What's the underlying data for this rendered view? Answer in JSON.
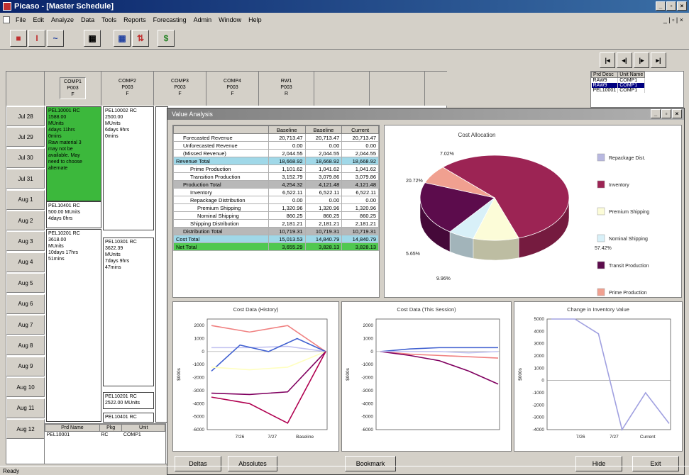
{
  "window": {
    "title": "Picaso - [Master Schedule]",
    "min": "_",
    "max": "▫",
    "close": "×"
  },
  "menu": [
    "File",
    "Edit",
    "Analyze",
    "Data",
    "Tools",
    "Reports",
    "Forecasting",
    "Admin",
    "Window",
    "Help"
  ],
  "menu_right": "_ | ▫ | ×",
  "toolbar": {
    "t1": "■",
    "t2": "I",
    "t3": "~",
    "t4": "▦",
    "t5": "▦",
    "t6": "⇅",
    "t7": "$"
  },
  "gridtools": [
    "|◂",
    "◂|",
    "|▸",
    "▸|"
  ],
  "schedule": {
    "columns": [
      {
        "name": "COMP1",
        "line2": "P003",
        "line3": "F"
      },
      {
        "name": "COMP2",
        "line2": "P003",
        "line3": "F"
      },
      {
        "name": "COMP3",
        "line2": "P003",
        "line3": "F"
      },
      {
        "name": "COMP4",
        "line2": "P003",
        "line3": "F"
      },
      {
        "name": "RW1",
        "line2": "P003",
        "line3": "R"
      }
    ],
    "rows": [
      "Jul 28",
      "Jul 29",
      "Jul 30",
      "Jul 31",
      "Aug 1",
      "Aug 2",
      "Aug 3",
      "Aug 4",
      "Aug 5",
      "Aug 6",
      "Aug 7",
      "Aug 8",
      "Aug 9",
      "Aug 10",
      "Aug 11",
      "Aug 12"
    ],
    "cells": {
      "c1": "PEL10001 RC\n1588.00\nMUnits\n4days 11hrs\n0mins\nRaw material 3\nmay not be\navailable. May\nneed to choose\nalternate",
      "c2": "PEL10002 RC\n2500.00\nMUnits\n6days 9hrs\n0mins",
      "c3": "PEL10401 RC\n500.00 MUnits\n4days 0hrs",
      "c4": "PEL10201 RC\n3618.00\nMUnits\n10days 17hrs\n51mins",
      "c5": "PEL10301 RC\n3622.39\nMUnits\n7days 9hrs\n47mins",
      "c6": "PEL10201 RC\n2522.00 MUnits",
      "c7": "PEL10401 RC"
    }
  },
  "list": {
    "headers": [
      "Prd Desc",
      "Unit Name"
    ],
    "rows": [
      [
        "RAW9",
        "COMP1"
      ],
      [
        "RAW9",
        "COMP1"
      ],
      [
        "PEL10001",
        "COMP1"
      ]
    ]
  },
  "prd_panel": {
    "headers": [
      "Prd Name",
      "Pkg",
      "Unit"
    ],
    "rows": [
      [
        "PEL10001",
        "RC",
        "COMP1"
      ]
    ]
  },
  "value_analysis": {
    "title": "Value Analysis",
    "headers": [
      "",
      "Baseline",
      "Baseline",
      "Current"
    ],
    "rows": [
      {
        "label": "Forecasted Revenue",
        "v": [
          "20,713.47",
          "20,713.47",
          "20,713.47"
        ],
        "style": "",
        "indent": 1
      },
      {
        "label": "Unforecasted Revenue",
        "v": [
          "0.00",
          "0.00",
          "0.00"
        ],
        "style": "",
        "indent": 1
      },
      {
        "label": "(Missed Revenue)",
        "v": [
          "2,044.55",
          "2,044.55",
          "2,044.55"
        ],
        "style": "",
        "indent": 1
      },
      {
        "label": "Revenue Total",
        "v": [
          "18,668.92",
          "18,668.92",
          "18,668.92"
        ],
        "style": "cyan",
        "indent": 0
      },
      {
        "label": "Prime Production",
        "v": [
          "1,101.62",
          "1,041.62",
          "1,041.62"
        ],
        "style": "",
        "indent": 2
      },
      {
        "label": "Transition Production",
        "v": [
          "3,152.79",
          "3,079.86",
          "3,079.86"
        ],
        "style": "",
        "indent": 2
      },
      {
        "label": "Production Total",
        "v": [
          "4,254.32",
          "4,121.48",
          "4,121.48"
        ],
        "style": "grey",
        "indent": 1
      },
      {
        "label": "Inventory",
        "v": [
          "6,522.11",
          "6,522.11",
          "6,522.11"
        ],
        "style": "",
        "indent": 2
      },
      {
        "label": "Repackage Distribution",
        "v": [
          "0.00",
          "0.00",
          "0.00"
        ],
        "style": "",
        "indent": 2
      },
      {
        "label": "Premium Shipping",
        "v": [
          "1,320.96",
          "1,320.96",
          "1,320.96"
        ],
        "style": "",
        "indent": 3
      },
      {
        "label": "Nominal Shipping",
        "v": [
          "860.25",
          "860.25",
          "860.25"
        ],
        "style": "",
        "indent": 3
      },
      {
        "label": "Shipping Distribution",
        "v": [
          "2,181.21",
          "2,181.21",
          "2,181.21"
        ],
        "style": "",
        "indent": 2
      },
      {
        "label": "Distribution Total",
        "v": [
          "10,719.31",
          "10,719.31",
          "10,719.31"
        ],
        "style": "grey",
        "indent": 1
      },
      {
        "label": "Cost Total",
        "v": [
          "15,013.53",
          "14,840.79",
          "14,840.79"
        ],
        "style": "cyan",
        "indent": 0
      },
      {
        "label": "Net Total",
        "v": [
          "3,655.29",
          "3,828.13",
          "3,828.13"
        ],
        "style": "gr",
        "indent": 0
      }
    ]
  },
  "chart_data": [
    {
      "type": "pie",
      "title": "Cost Allocation",
      "slices": [
        {
          "name": "Repackage Dist.",
          "value": 0.0,
          "color": "#b8b8e0"
        },
        {
          "name": "Inventory",
          "value": 57.42,
          "color": "#9c2454"
        },
        {
          "name": "Premium Shipping",
          "value": 9.96,
          "color": "#fcfcd8"
        },
        {
          "name": "Nominal Shipping",
          "value": 5.65,
          "color": "#d8f0f8"
        },
        {
          "name": "Transit Production",
          "value": 20.72,
          "color": "#5c0c4c"
        },
        {
          "name": "Prime Production",
          "value": 7.02,
          "color": "#f0a090"
        }
      ],
      "labels": [
        "7.02%",
        "20.72%",
        "57.42%",
        "5.65%",
        "9.96%"
      ],
      "legend": "right"
    },
    {
      "type": "line",
      "title": "Cost Data (History)",
      "ylabel": "$000s",
      "categories": [
        "7/26",
        "7/27",
        "Baseline"
      ],
      "ylim": [
        -6000,
        2500
      ],
      "yticks": [
        "2000",
        "1000",
        "0",
        "-1000",
        "-2000",
        "-3000",
        "-4000",
        "-5000",
        "-6000"
      ],
      "series": [
        {
          "color": "#f08080",
          "values": [
            2000,
            1500,
            2000,
            0
          ]
        },
        {
          "color": "#c0c0f0",
          "values": [
            300,
            300,
            400,
            0
          ]
        },
        {
          "color": "#4060d0",
          "values": [
            -1500,
            500,
            0,
            1000,
            0
          ]
        },
        {
          "color": "#ffffc0",
          "values": [
            -1200,
            -1400,
            -1200,
            0
          ]
        },
        {
          "color": "#800060",
          "values": [
            -3200,
            -3300,
            -3100,
            0
          ]
        },
        {
          "color": "#b00050",
          "values": [
            -3500,
            -4000,
            -5500,
            0
          ]
        }
      ]
    },
    {
      "type": "line",
      "title": "Cost Data (This Session)",
      "ylabel": "$000s",
      "ylim": [
        -6000,
        2500
      ],
      "yticks": [
        "2000",
        "1000",
        "0",
        "-1000",
        "-2000",
        "-3000",
        "-4000",
        "-5000",
        "-6000"
      ],
      "series": [
        {
          "color": "#4060d0",
          "values": [
            0,
            200,
            300,
            300,
            300
          ]
        },
        {
          "color": "#f08080",
          "values": [
            0,
            -200,
            -300,
            -400,
            -500
          ]
        },
        {
          "color": "#800060",
          "values": [
            0,
            -300,
            -700,
            -1500,
            -2500
          ]
        },
        {
          "color": "#c0c0f0",
          "values": [
            0,
            0,
            0,
            -100,
            0
          ]
        }
      ]
    },
    {
      "type": "line",
      "title": "Change in Inventory Value",
      "ylabel": "$000s",
      "categories": [
        "7/26",
        "7/27",
        "Current"
      ],
      "ylim": [
        -4000,
        5000
      ],
      "yticks": [
        "5000",
        "4000",
        "3000",
        "2000",
        "1000",
        "0",
        "-1000",
        "-2000",
        "-3000",
        "-4000"
      ],
      "series": [
        {
          "color": "#a0a0e0",
          "values": [
            5000,
            5000,
            3800,
            -4000,
            -1000,
            -3500
          ]
        }
      ]
    }
  ],
  "buttons": {
    "deltas": "Deltas",
    "absolutes": "Absolutes",
    "bookmark": "Bookmark",
    "hide": "Hide",
    "exit": "Exit"
  },
  "status": "Ready"
}
